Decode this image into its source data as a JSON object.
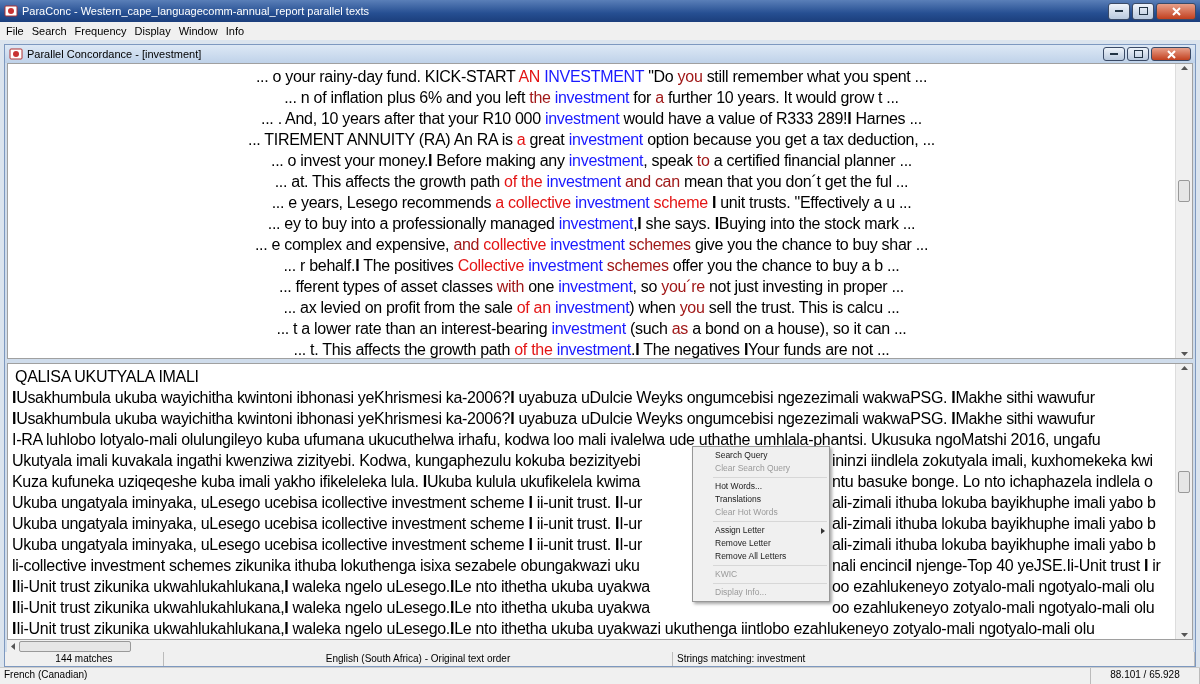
{
  "window": {
    "title": "ParaConc - Western_cape_languagecomm-annual_report parallel texts"
  },
  "menu": [
    "File",
    "Search",
    "Frequency",
    "Display",
    "Window",
    "Info"
  ],
  "child_window": {
    "title": "Parallel Concordance - [investment]"
  },
  "concordance": [
    [
      {
        "text": "... o your rainy-day fund. KICK-START ",
        "kind": "plain"
      },
      {
        "text": "AN",
        "kind": "hot"
      },
      {
        "text": " INVESTMENT",
        "kind": "key"
      },
      {
        "text": " \"Do ",
        "kind": "plain"
      },
      {
        "text": "you",
        "kind": "near"
      },
      {
        "text": " still remember what you spent  ...",
        "kind": "plain"
      }
    ],
    [
      {
        "text": "... n of inflation plus 6% and you left ",
        "kind": "plain"
      },
      {
        "text": "the",
        "kind": "near"
      },
      {
        "text": " investment",
        "kind": "key"
      },
      {
        "text": " for ",
        "kind": "plain"
      },
      {
        "text": "a",
        "kind": "near"
      },
      {
        "text": " further 10 years. It would grow t ...",
        "kind": "plain"
      }
    ],
    [
      {
        "text": "... . And, 10 years after that your R10 000 ",
        "kind": "plain"
      },
      {
        "text": "investment",
        "kind": "key"
      },
      {
        "text": " would have a value of R333 289!**I** Harnes ...",
        "kind": "plain"
      }
    ],
    [
      {
        "text": "... TIREMENT ANNUITY (RA) An RA is ",
        "kind": "plain"
      },
      {
        "text": "a",
        "kind": "hot"
      },
      {
        "text": " great ",
        "kind": "plain"
      },
      {
        "text": "investment",
        "kind": "key"
      },
      {
        "text": " option because you get a tax deduction, ...",
        "kind": "plain"
      }
    ],
    [
      {
        "text": "... o invest your money.**I** Before making any ",
        "kind": "plain"
      },
      {
        "text": "investment",
        "kind": "key"
      },
      {
        "text": ", speak ",
        "kind": "plain"
      },
      {
        "text": "to",
        "kind": "near"
      },
      {
        "text": " a certified financial planner ...",
        "kind": "plain"
      }
    ],
    [
      {
        "text": "... at. This affects the growth path ",
        "kind": "plain"
      },
      {
        "text": "of the",
        "kind": "hot"
      },
      {
        "text": " investment",
        "kind": "key"
      },
      {
        "text": " and can",
        "kind": "near"
      },
      {
        "text": " mean that you don´t get the ful ...",
        "kind": "plain"
      }
    ],
    [
      {
        "text": "... e years, Lesego recommends ",
        "kind": "plain"
      },
      {
        "text": "a collective",
        "kind": "hot"
      },
      {
        "text": " investment",
        "kind": "key"
      },
      {
        "text": " scheme",
        "kind": "hot"
      },
      {
        "text": " **I** unit trusts. \"Effectively a u ...",
        "kind": "plain"
      }
    ],
    [
      {
        "text": "... ey to buy into a professionally managed ",
        "kind": "plain"
      },
      {
        "text": "investment",
        "kind": "key"
      },
      {
        "text": ",**I** she says. **I**Buying into the stock mark ...",
        "kind": "plain"
      }
    ],
    [
      {
        "text": "... e complex and expensive, ",
        "kind": "plain"
      },
      {
        "text": "and",
        "kind": "near"
      },
      {
        "text": " collective",
        "kind": "hot"
      },
      {
        "text": " investment",
        "kind": "key"
      },
      {
        "text": " schemes",
        "kind": "near"
      },
      {
        "text": " give you the chance to buy shar ...",
        "kind": "plain"
      }
    ],
    [
      {
        "text": "... r behalf.**I** The positives ",
        "kind": "plain"
      },
      {
        "text": "Collective",
        "kind": "hot"
      },
      {
        "text": " investment",
        "kind": "key"
      },
      {
        "text": " schemes",
        "kind": "near"
      },
      {
        "text": " offer you the chance to buy a b ...",
        "kind": "plain"
      }
    ],
    [
      {
        "text": "... fferent types of asset classes ",
        "kind": "plain"
      },
      {
        "text": "with",
        "kind": "near"
      },
      {
        "text": " one ",
        "kind": "plain"
      },
      {
        "text": "investment",
        "kind": "key"
      },
      {
        "text": ", so ",
        "kind": "plain"
      },
      {
        "text": "you´re",
        "kind": "near"
      },
      {
        "text": " not just investing in proper ...",
        "kind": "plain"
      }
    ],
    [
      {
        "text": "... ax levied on profit from the sale ",
        "kind": "plain"
      },
      {
        "text": "of an",
        "kind": "hot"
      },
      {
        "text": " investment",
        "kind": "key"
      },
      {
        "text": ") when ",
        "kind": "plain"
      },
      {
        "text": "you",
        "kind": "near"
      },
      {
        "text": " sell the trust. This is calcu ...",
        "kind": "plain"
      }
    ],
    [
      {
        "text": "... t a lower rate than an interest-bearing ",
        "kind": "plain"
      },
      {
        "text": "investment",
        "kind": "key"
      },
      {
        "text": " (such ",
        "kind": "plain"
      },
      {
        "text": "as",
        "kind": "near"
      },
      {
        "text": " a bond on a house), so it can  ...",
        "kind": "plain"
      }
    ],
    [
      {
        "text": "... t. This affects the growth path ",
        "kind": "plain"
      },
      {
        "text": "of the",
        "kind": "hot"
      },
      {
        "text": " investment",
        "kind": "key"
      },
      {
        "text": ".**I** The negatives **I**Your funds are not ...",
        "kind": "plain"
      }
    ]
  ],
  "translation": {
    "heading": "QALISA UKUTYALA IMALI",
    "lines": [
      {
        "left": "**I**Usakhumbula ukuba wayichitha kwintoni ibhonasi yeKhrismesi ka-2006?**I** uyabuza uDulcie Weyks ongumcebisi ngezezimali wakwaPSG. **I**Makhe sithi wawufur"
      },
      {
        "left": "**I**Usakhumbula ukuba wayichitha kwintoni ibhonasi yeKhrismesi ka-2006?**I** uyabuza uDulcie Weyks ongumcebisi ngezezimali wakwaPSG. **I**Makhe sithi wawufur"
      },
      {
        "left": "I-RA luhlobo lotyalo-mali olulungileyo kuba ufumana ukucuthelwa irhafu, kodwa loo mali ivalelwa ude uthathe umhlala-phantsi. Ukusuka ngoMatshi 2016, ungafu"
      },
      {
        "left": "Ukutyala imali kuvakala ingathi kwenziwa zizityebi. Kodwa, kungaphezulu kokuba bezizityebi",
        "right": "ininzi iindlela zokutyala imali, kuxhomekeka kwi"
      },
      {
        "left": "Kuza kufuneka uziqeqeshe kuba imali yakho ifikeleleka lula. **I**Ukuba kulula ukufikelela kwima",
        "right": "ntu basuke bonge. Lo nto ichaphazela indlela o"
      },
      {
        "left": "Ukuba ungatyala iminyaka, uLesego ucebisa icollective investment scheme **I** ii-unit trust. **I**I-ur",
        "right": "ali-zimali ithuba lokuba bayikhuphe imali yabo b"
      },
      {
        "left": "Ukuba ungatyala iminyaka, uLesego ucebisa icollective investment scheme **I** ii-unit trust. **I**I-ur",
        "right": "ali-zimali ithuba lokuba bayikhuphe imali yabo b"
      },
      {
        "left": "Ukuba ungatyala iminyaka, uLesego ucebisa icollective investment scheme **I** ii-unit trust. **I**I-ur",
        "right": "ali-zimali ithuba lokuba bayikhuphe imali yabo b"
      },
      {
        "left": "li-collective investment schemes zikunika ithuba lokuthenga isixa sezabele obungakwazi uku",
        "right": "nali encinci**I** njenge-Top 40 yeJSE.Ii-Unit trust **I** ir"
      },
      {
        "left": "**I**Ii-Unit trust zikunika ukwahlukahlukana,**I** waleka ngelo uLesego.**I**Le nto ithetha ukuba uyakwa",
        "right": "oo ezahlukeneyo zotyalo-mali ngotyalo-mali olu"
      },
      {
        "left": "**I**Ii-Unit trust zikunika ukwahlukahlukana,**I** waleka ngelo uLesego.**I**Le nto ithetha ukuba uyakwa",
        "right": "oo ezahlukeneyo zotyalo-mali ngotyalo-mali olu"
      },
      {
        "left": "**I**Ii-Unit trust zikunika ukwahlukahlukana,**I** waleka ngelo uLesego.**I**Le nto ithetha ukuba uyakwazi ukuthenga iintlobo ezahlukeneyo zotyalo-mali ngotyalo-mali olu"
      }
    ]
  },
  "context_menu": [
    [
      {
        "label": "Search Query",
        "disabled": false
      },
      {
        "label": "Clear Search Query",
        "disabled": true
      }
    ],
    [
      {
        "label": "Hot Words...",
        "disabled": false
      },
      {
        "label": "Translations",
        "disabled": false
      },
      {
        "label": "Clear Hot Words",
        "disabled": true
      }
    ],
    [
      {
        "label": "Assign Letter",
        "disabled": false,
        "submenu": true
      },
      {
        "label": "Remove Letter",
        "disabled": false
      },
      {
        "label": "Remove All Letters",
        "disabled": false
      }
    ],
    [
      {
        "label": "KWIC",
        "disabled": true
      }
    ],
    [
      {
        "label": "Display Info...",
        "disabled": true
      }
    ]
  ],
  "child_status": [
    "144 matches",
    "English (South Africa) - Original text order",
    "Strings matching: investment"
  ],
  "status_bar": {
    "language": "French (Canadian)",
    "position": "88.101 / 65.928"
  }
}
